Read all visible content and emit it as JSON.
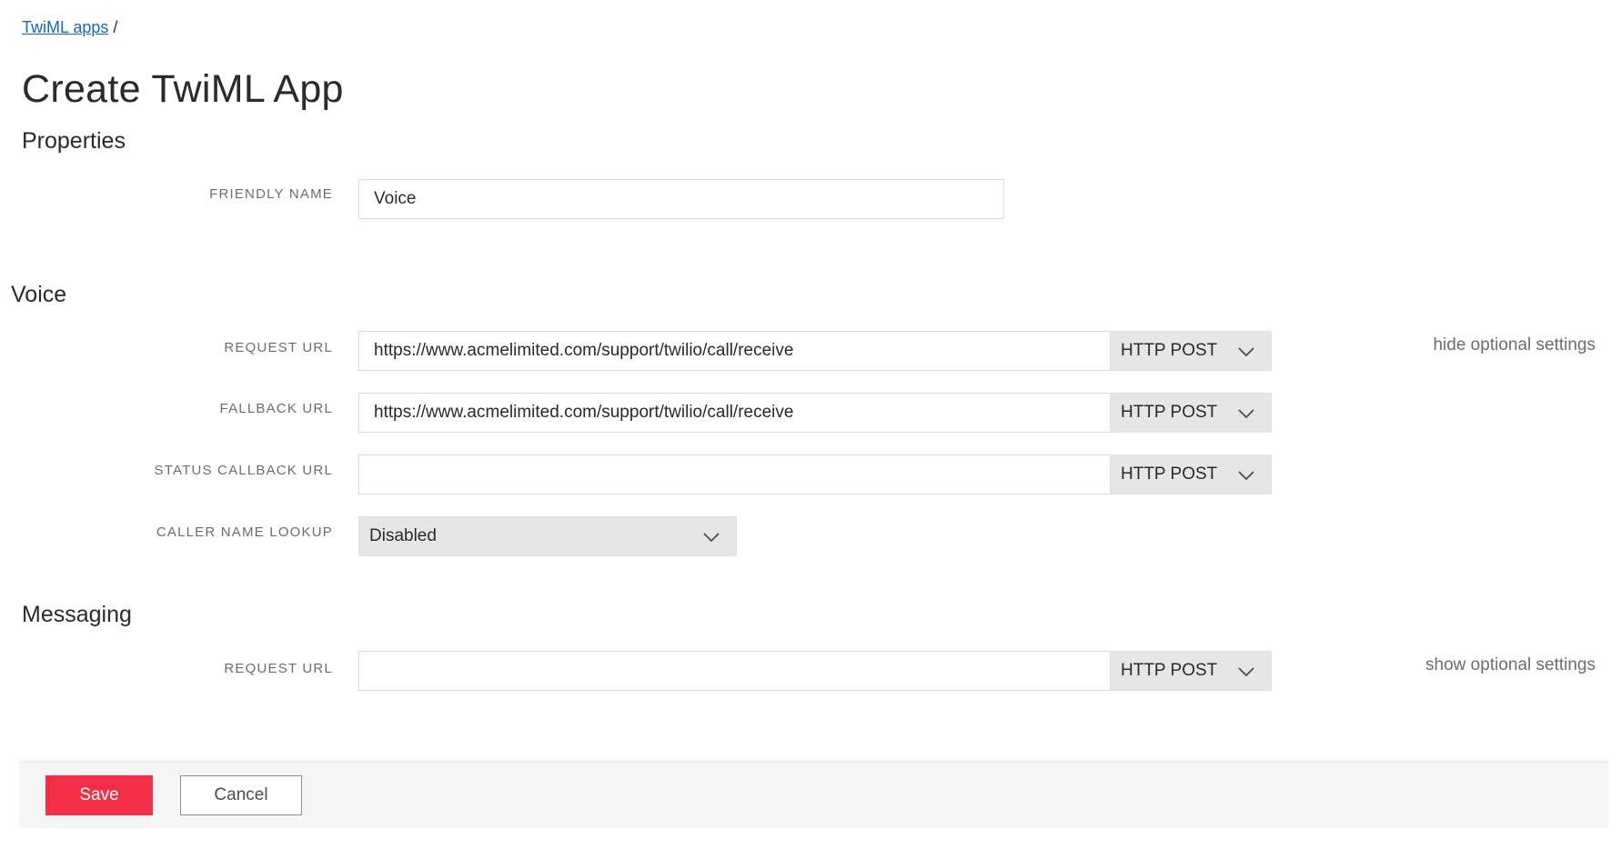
{
  "breadcrumb": {
    "link_label": "TwiML apps",
    "separator": "/"
  },
  "page_title": "Create TwiML App",
  "properties": {
    "section_title": "Properties",
    "friendly_name": {
      "label": "FRIENDLY NAME",
      "value": "Voice"
    }
  },
  "voice": {
    "section_title": "Voice",
    "request_url": {
      "label": "REQUEST URL",
      "value": "https://www.acmelimited.com/support/twilio/call/receive",
      "method": "HTTP POST"
    },
    "fallback_url": {
      "label": "FALLBACK URL",
      "value": "https://www.acmelimited.com/support/twilio/call/receive",
      "method": "HTTP POST"
    },
    "status_callback_url": {
      "label": "STATUS CALLBACK URL",
      "value": "",
      "method": "HTTP POST"
    },
    "caller_name_lookup": {
      "label": "CALLER NAME LOOKUP",
      "value": "Disabled"
    },
    "optional_settings_label": "hide optional settings"
  },
  "messaging": {
    "section_title": "Messaging",
    "request_url": {
      "label": "REQUEST URL",
      "value": "",
      "method": "HTTP POST"
    },
    "optional_settings_label": "show optional settings"
  },
  "footer": {
    "save_label": "Save",
    "cancel_label": "Cancel"
  },
  "colors": {
    "save_button": "#f22f46",
    "link": "#1a66c8",
    "select_background": "#e6e6e6",
    "footer_background": "#f5f5f5"
  }
}
